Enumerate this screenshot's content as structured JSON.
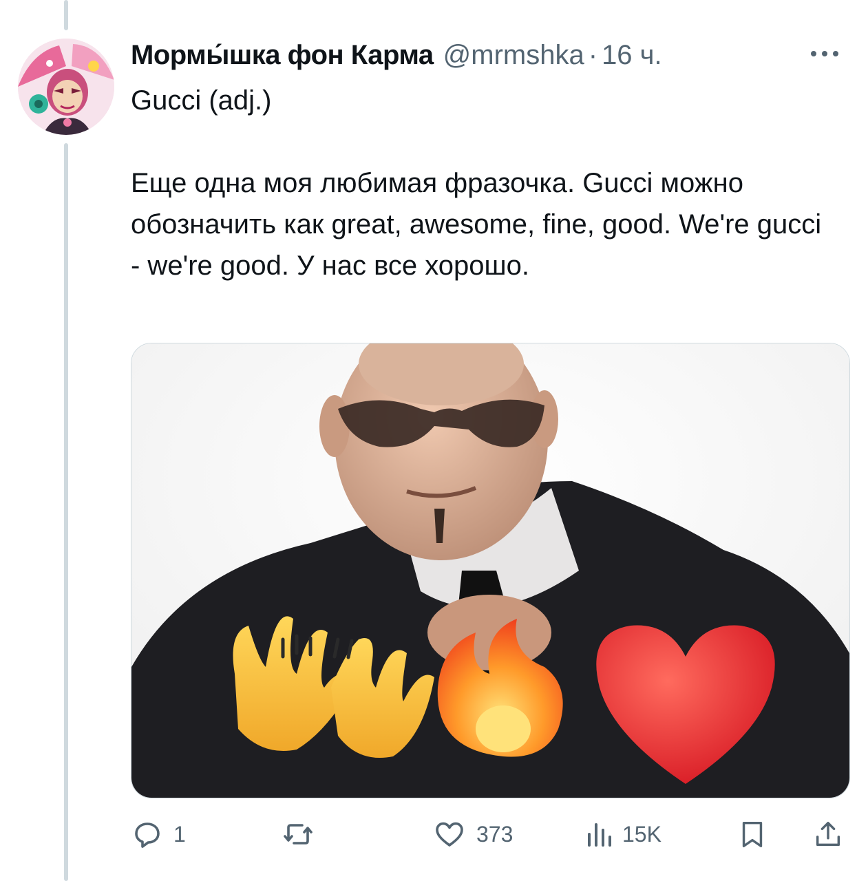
{
  "post": {
    "display_name": "Мормы́шка фон Карма",
    "handle": "@mrmshka",
    "separator": "·",
    "time": "16 ч.",
    "text": "Gucci (adj.)\n\nЕще одна моя любимая фразочка. Gucci можно обозначить как great, awesome, fine, good. We're gucci - we're good. У нас все хорошо."
  },
  "media": {
    "emojis": [
      "🙌",
      "🔥",
      "❤️"
    ]
  },
  "actions": {
    "reply": {
      "icon": "reply-icon",
      "count": "1"
    },
    "repost": {
      "icon": "repost-icon",
      "count": ""
    },
    "like": {
      "icon": "heart-icon",
      "count": "373"
    },
    "views": {
      "icon": "views-icon",
      "count": "15K"
    },
    "bookmark": {
      "icon": "bookmark-icon"
    },
    "share": {
      "icon": "share-icon"
    }
  },
  "colors": {
    "text": "#0f1419",
    "secondary": "#536471",
    "border": "#cfd9de"
  }
}
